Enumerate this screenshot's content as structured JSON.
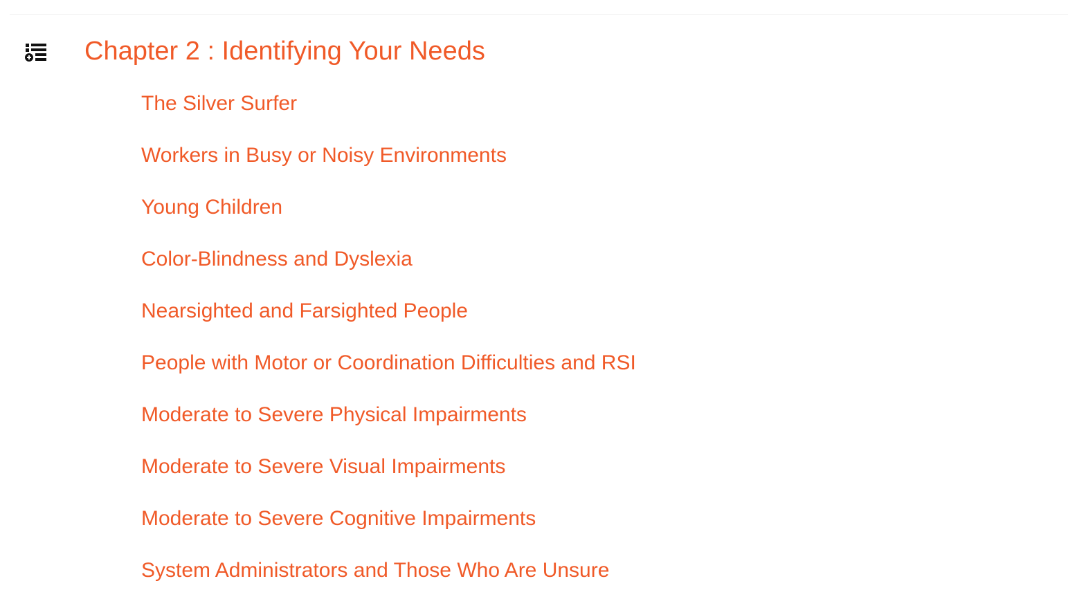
{
  "colors": {
    "link": "#f05a28",
    "icon": "#111111",
    "background": "#ffffff"
  },
  "toc_toggle": {
    "icon": "playlist-add-icon"
  },
  "chapter": {
    "title": "Chapter 2 : Identifying Your Needs"
  },
  "sections": [
    {
      "label": "The Silver Surfer"
    },
    {
      "label": "Workers in Busy or Noisy Environments"
    },
    {
      "label": "Young Children"
    },
    {
      "label": "Color-Blindness and Dyslexia"
    },
    {
      "label": "Nearsighted and Farsighted People"
    },
    {
      "label": "People with Motor or Coordination Difficulties and RSI"
    },
    {
      "label": "Moderate to Severe Physical Impairments"
    },
    {
      "label": "Moderate to Severe Visual Impairments"
    },
    {
      "label": "Moderate to Severe Cognitive Impairments"
    },
    {
      "label": "System Administrators and Those Who Are Unsure"
    }
  ]
}
